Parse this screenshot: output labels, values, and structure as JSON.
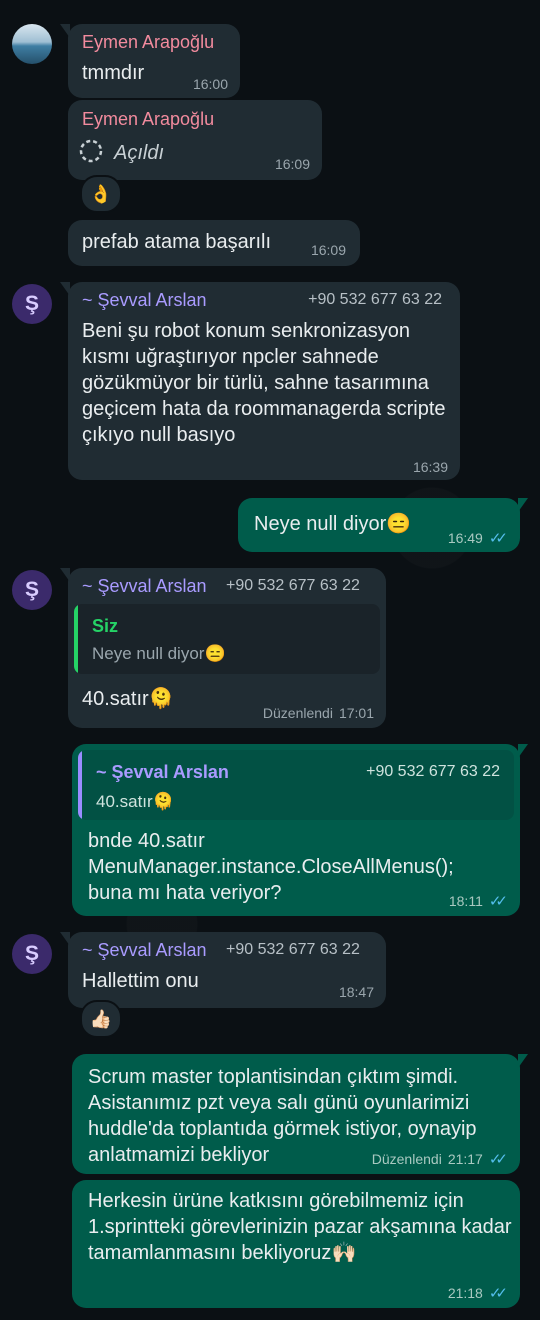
{
  "messages": {
    "m1": {
      "sender": "Eymen Arapoğlu",
      "text": "tmmdır",
      "time": "16:00"
    },
    "m2": {
      "sender": "Eymen Arapoğlu",
      "text": "Açıldı",
      "time": "16:09",
      "reaction": "👌"
    },
    "m3": {
      "text": "prefab atama başarılı",
      "time": "16:09"
    },
    "m4": {
      "sender": "~ Şevval Arslan",
      "phone": "+90 532 677 63 22",
      "text": "Beni şu robot konum senkronizasyon kısmı uğraştırıyor npcler sahnede gözükmüyor bir türlü, sahne tasarımına geçicem hata da roommanagerda scripte çıkıyo null basıyo",
      "time": "16:39"
    },
    "m5": {
      "text": "Neye null diyor",
      "emoji": "😑",
      "time": "16:49"
    },
    "m6": {
      "sender": "~ Şevval Arslan",
      "phone": "+90 532 677 63 22",
      "quote_sender": "Siz",
      "quote_text": "Neye null diyor😑",
      "text": "40.satır",
      "emoji": "🫠",
      "edited": "Düzenlendi",
      "time": "17:01"
    },
    "m7": {
      "quote_sender": "~ Şevval Arslan",
      "quote_phone": "+90 532 677 63 22",
      "quote_text": "40.satır🫠",
      "text": "bnde 40.satır\nMenuManager.instance.CloseAllMenus();\nbuna mı hata veriyor?",
      "time": "18:11"
    },
    "m8": {
      "sender": "~ Şevval Arslan",
      "phone": "+90 532 677 63 22",
      "text": "Hallettim onu",
      "time": "18:47",
      "reaction": "👍🏻"
    },
    "m9": {
      "text": "Scrum master toplantisindan çıktım şimdi. Asistanımız pzt veya salı günü oyunlarimizi huddle'da toplantıda görmek istiyor, oynayip anlatmamizi bekliyor",
      "edited": "Düzenlendi",
      "time": "21:17"
    },
    "m10": {
      "text": "Herkesin ürüne katkısını görebilmemiz için 1.sprintteki görevlerinizin pazar akşamına kadar tamamlanmasını bekliyoruz",
      "emoji": "🙌🏻",
      "time": "21:18"
    }
  },
  "avatars": {
    "sevval_letter": "Ş"
  },
  "icons": {
    "read_receipt": "double-check-icon",
    "loading": "spinner-icon"
  },
  "colors": {
    "incoming": "#202c33",
    "outgoing": "#005c4b",
    "ticks": "#53bdeb",
    "pink_name": "#f28b9e",
    "purple_name": "#a99bff",
    "quote_green": "#25d366",
    "quote_purple": "#9a8cff"
  }
}
